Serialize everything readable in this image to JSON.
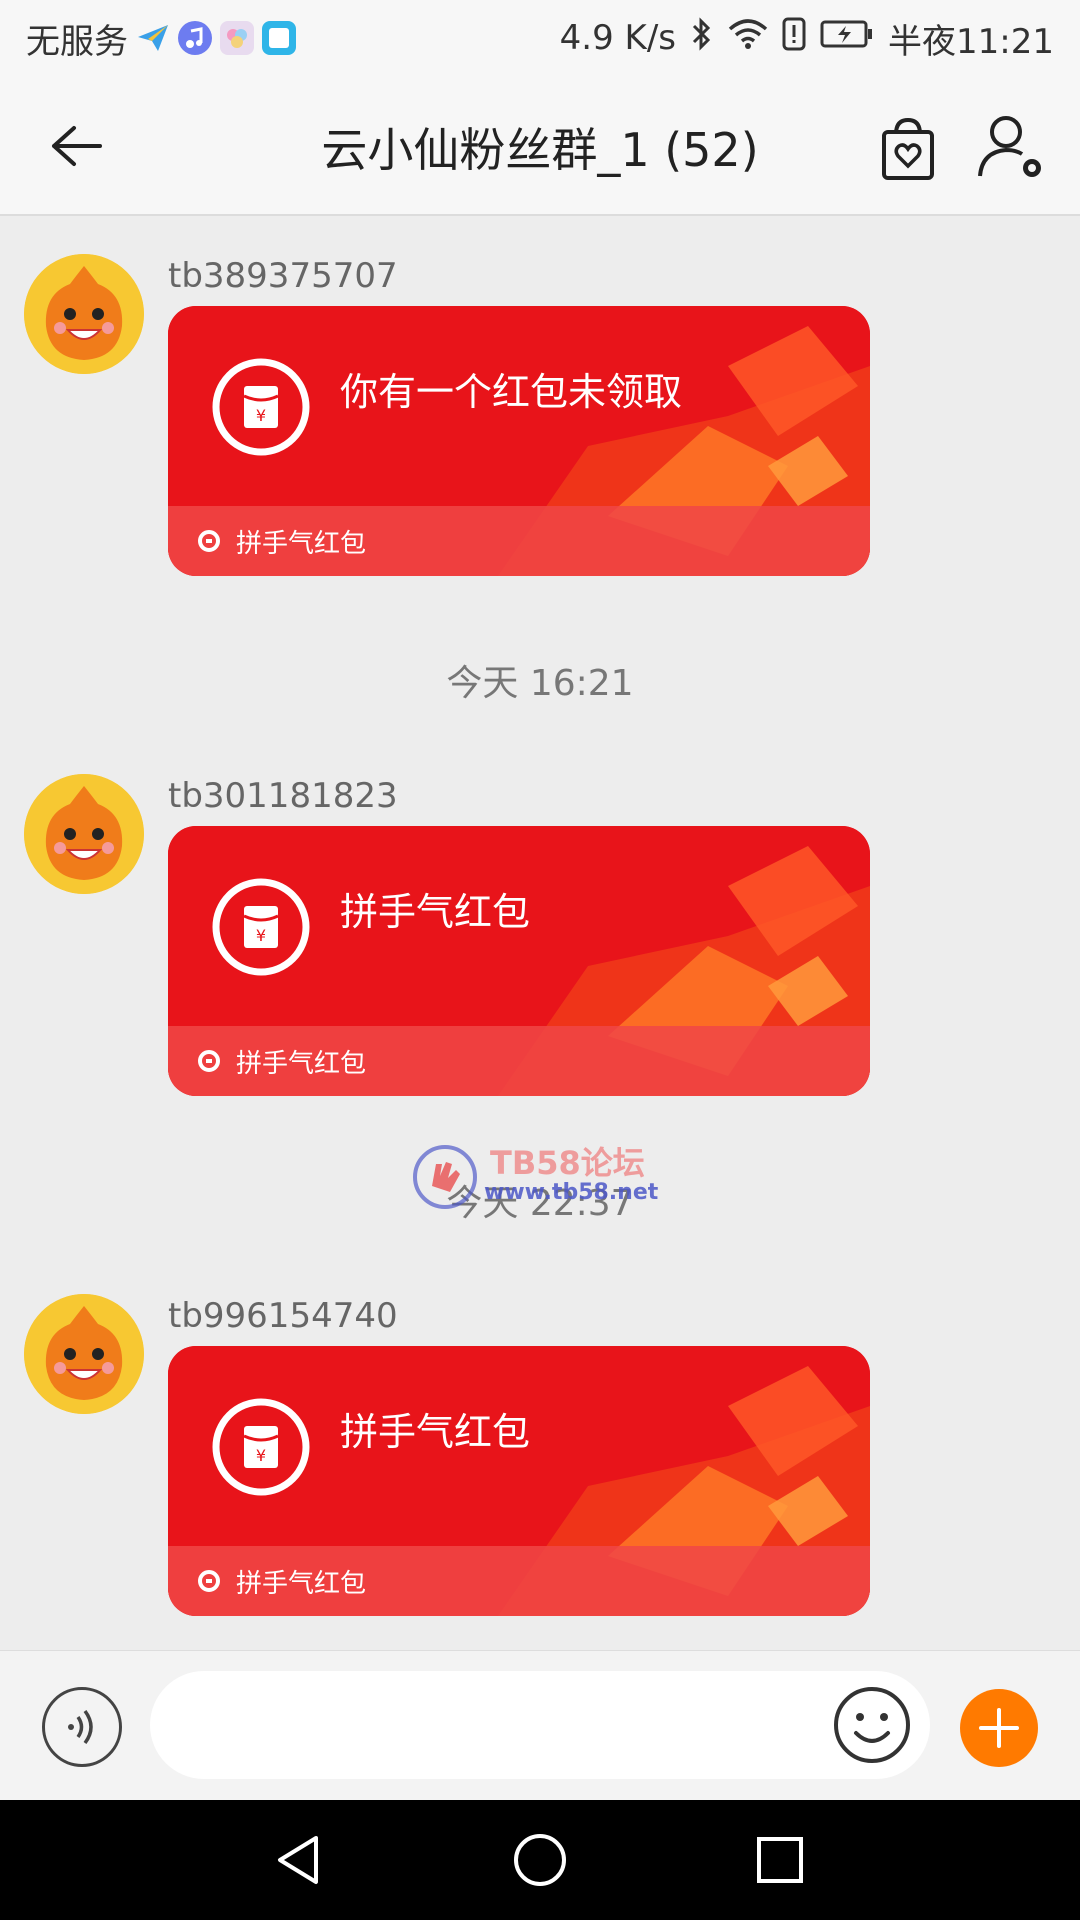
{
  "status_bar": {
    "carrier": "无服务",
    "speed": "4.9 K/s",
    "time": "半夜11:21",
    "icons": [
      "paper-plane-icon",
      "music-app-icon",
      "photos-app-icon",
      "tablet-app-icon",
      "bluetooth-icon",
      "wifi-icon",
      "alert-icon",
      "battery-charging-icon"
    ]
  },
  "title_bar": {
    "title": "云小仙粉丝群_1 (52)",
    "back_icon": "back-arrow-icon",
    "shop_icon": "shopping-bag-heart-icon",
    "member_icon": "user-settings-icon"
  },
  "messages": [
    {
      "sender": "tb389375707",
      "packet_text": "你有一个红包未领取",
      "packet_footer": "拼手气红包"
    },
    {
      "sender": "tb301181823",
      "packet_text": "拼手气红包",
      "packet_footer": "拼手气红包"
    },
    {
      "sender": "tb996154740",
      "packet_text": "拼手气红包",
      "packet_footer": "拼手气红包"
    }
  ],
  "time_separators": [
    "今天  16:21",
    "今天  22:37"
  ],
  "watermark": {
    "line1": "TB58论坛",
    "line2": "www.tb58.net"
  },
  "input_bar": {
    "input_value": "",
    "voice_icon": "voice-icon",
    "emoji_icon": "smiley-icon",
    "plus_icon": "plus-icon"
  },
  "colors": {
    "packet_red": "#e8141a",
    "accent_orange": "#ff7a00",
    "background": "#ededed"
  }
}
